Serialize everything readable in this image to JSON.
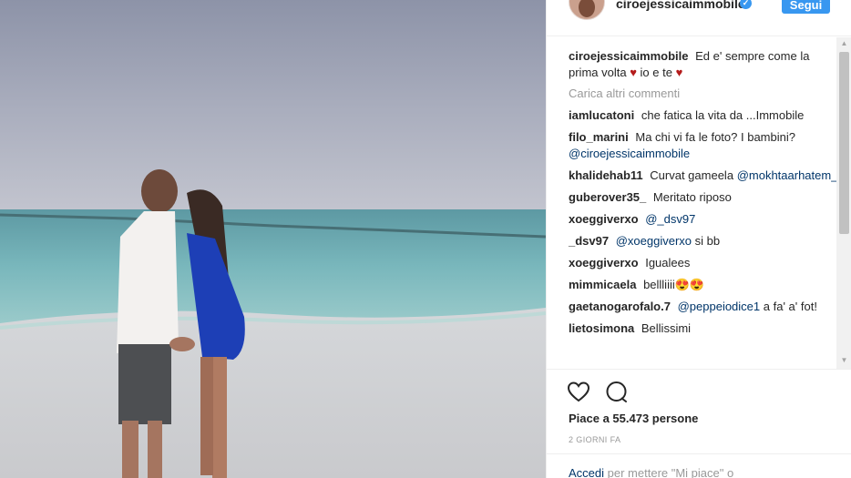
{
  "post": {
    "author": "ciroejessicaimmobile",
    "follow_label": "Segui",
    "verified": true
  },
  "caption": {
    "author": "ciroejessicaimmobile",
    "text_1": "Ed e' sempre come la prima volta",
    "heart": "♥",
    "text_2": "io e te"
  },
  "load_more_label": "Carica altri commenti",
  "comments": [
    {
      "author": "iamlucatoni",
      "text": "che fatica la vita da ...Immobile",
      "mention": ""
    },
    {
      "author": "filo_marini",
      "text": "Ma chi vi fa le foto? I bambini?",
      "mention": "@ciroejessicaimmobile"
    },
    {
      "author": "khalidehab11",
      "text": "Curvat gameela",
      "mention": "@mokhtaarhatem_"
    },
    {
      "author": "guberover35_",
      "text": "Meritato riposo",
      "mention": ""
    },
    {
      "author": "xoeggiverxo",
      "text": "",
      "mention": "@_dsv97"
    },
    {
      "author": "_dsv97",
      "mention": "@xoeggiverxo",
      "text": "si bb"
    },
    {
      "author": "xoeggiverxo",
      "text": "Igualees",
      "mention": ""
    },
    {
      "author": "mimmicaela",
      "text": "bellliiii😍😍",
      "mention": ""
    },
    {
      "author": "gaetanogarofalo.7",
      "mention": "@peppeiodice1",
      "text": "a fa' a' fot!"
    },
    {
      "author": "lietosimona",
      "text": "Bellissimi",
      "mention": ""
    }
  ],
  "likes_label": "Piace a 55.473 persone",
  "timestamp": "2 GIORNI FA",
  "login": {
    "link": "Accedi",
    "text": "per mettere \"Mi piace\" o"
  },
  "icons": {
    "like": "heart-outline-icon",
    "comment": "speech-bubble-icon",
    "verified": "verified-badge-icon"
  },
  "colors": {
    "accent": "#3897f0",
    "link": "#003569",
    "heart": "#b41b1b",
    "muted": "#999999"
  }
}
